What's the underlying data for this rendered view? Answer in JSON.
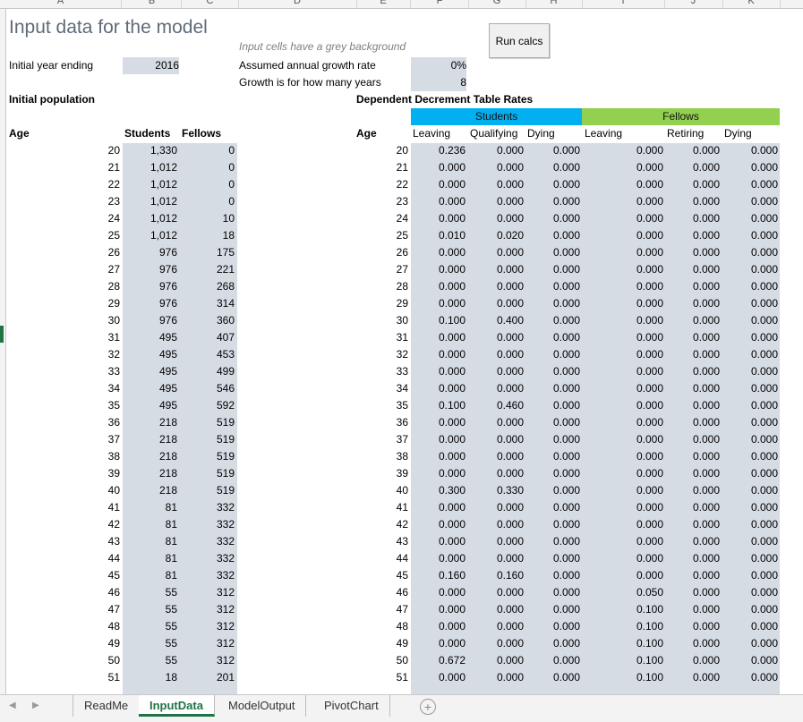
{
  "columns": [
    "A",
    "B",
    "C",
    "D",
    "E",
    "F",
    "G",
    "H",
    "I",
    "J",
    "K"
  ],
  "title": "Input data for the model",
  "note": "Input cells have a grey background",
  "run_button": "Run calcs",
  "initial_year_label": "Initial year ending",
  "initial_year_value": "2016",
  "growth_rate_label": "Assumed annual growth rate",
  "growth_rate_value": "0%",
  "growth_years_label": "Growth is for how many years",
  "growth_years_value": "8",
  "initial_population_label": "Initial population",
  "decrement_title": "Dependent Decrement Table Rates",
  "students_header": "Students",
  "fellows_header": "Fellows",
  "left_headers": {
    "age": "Age",
    "students": "Students",
    "fellows": "Fellows"
  },
  "right_headers": {
    "age": "Age",
    "s_leaving": "Leaving",
    "s_qualifying": "Qualifying",
    "s_dying": "Dying",
    "f_leaving": "Leaving",
    "f_retiring": "Retiring",
    "f_dying": "Dying"
  },
  "rows": [
    [
      "20",
      "1,330",
      "0",
      "20",
      "0.236",
      "0.000",
      "0.000",
      "0.000",
      "0.000",
      "0.000"
    ],
    [
      "21",
      "1,012",
      "0",
      "21",
      "0.000",
      "0.000",
      "0.000",
      "0.000",
      "0.000",
      "0.000"
    ],
    [
      "22",
      "1,012",
      "0",
      "22",
      "0.000",
      "0.000",
      "0.000",
      "0.000",
      "0.000",
      "0.000"
    ],
    [
      "23",
      "1,012",
      "0",
      "23",
      "0.000",
      "0.000",
      "0.000",
      "0.000",
      "0.000",
      "0.000"
    ],
    [
      "24",
      "1,012",
      "10",
      "24",
      "0.000",
      "0.000",
      "0.000",
      "0.000",
      "0.000",
      "0.000"
    ],
    [
      "25",
      "1,012",
      "18",
      "25",
      "0.010",
      "0.020",
      "0.000",
      "0.000",
      "0.000",
      "0.000"
    ],
    [
      "26",
      "976",
      "175",
      "26",
      "0.000",
      "0.000",
      "0.000",
      "0.000",
      "0.000",
      "0.000"
    ],
    [
      "27",
      "976",
      "221",
      "27",
      "0.000",
      "0.000",
      "0.000",
      "0.000",
      "0.000",
      "0.000"
    ],
    [
      "28",
      "976",
      "268",
      "28",
      "0.000",
      "0.000",
      "0.000",
      "0.000",
      "0.000",
      "0.000"
    ],
    [
      "29",
      "976",
      "314",
      "29",
      "0.000",
      "0.000",
      "0.000",
      "0.000",
      "0.000",
      "0.000"
    ],
    [
      "30",
      "976",
      "360",
      "30",
      "0.100",
      "0.400",
      "0.000",
      "0.000",
      "0.000",
      "0.000"
    ],
    [
      "31",
      "495",
      "407",
      "31",
      "0.000",
      "0.000",
      "0.000",
      "0.000",
      "0.000",
      "0.000"
    ],
    [
      "32",
      "495",
      "453",
      "32",
      "0.000",
      "0.000",
      "0.000",
      "0.000",
      "0.000",
      "0.000"
    ],
    [
      "33",
      "495",
      "499",
      "33",
      "0.000",
      "0.000",
      "0.000",
      "0.000",
      "0.000",
      "0.000"
    ],
    [
      "34",
      "495",
      "546",
      "34",
      "0.000",
      "0.000",
      "0.000",
      "0.000",
      "0.000",
      "0.000"
    ],
    [
      "35",
      "495",
      "592",
      "35",
      "0.100",
      "0.460",
      "0.000",
      "0.000",
      "0.000",
      "0.000"
    ],
    [
      "36",
      "218",
      "519",
      "36",
      "0.000",
      "0.000",
      "0.000",
      "0.000",
      "0.000",
      "0.000"
    ],
    [
      "37",
      "218",
      "519",
      "37",
      "0.000",
      "0.000",
      "0.000",
      "0.000",
      "0.000",
      "0.000"
    ],
    [
      "38",
      "218",
      "519",
      "38",
      "0.000",
      "0.000",
      "0.000",
      "0.000",
      "0.000",
      "0.000"
    ],
    [
      "39",
      "218",
      "519",
      "39",
      "0.000",
      "0.000",
      "0.000",
      "0.000",
      "0.000",
      "0.000"
    ],
    [
      "40",
      "218",
      "519",
      "40",
      "0.300",
      "0.330",
      "0.000",
      "0.000",
      "0.000",
      "0.000"
    ],
    [
      "41",
      "81",
      "332",
      "41",
      "0.000",
      "0.000",
      "0.000",
      "0.000",
      "0.000",
      "0.000"
    ],
    [
      "42",
      "81",
      "332",
      "42",
      "0.000",
      "0.000",
      "0.000",
      "0.000",
      "0.000",
      "0.000"
    ],
    [
      "43",
      "81",
      "332",
      "43",
      "0.000",
      "0.000",
      "0.000",
      "0.000",
      "0.000",
      "0.000"
    ],
    [
      "44",
      "81",
      "332",
      "44",
      "0.000",
      "0.000",
      "0.000",
      "0.000",
      "0.000",
      "0.000"
    ],
    [
      "45",
      "81",
      "332",
      "45",
      "0.160",
      "0.160",
      "0.000",
      "0.000",
      "0.000",
      "0.000"
    ],
    [
      "46",
      "55",
      "312",
      "46",
      "0.000",
      "0.000",
      "0.000",
      "0.050",
      "0.000",
      "0.000"
    ],
    [
      "47",
      "55",
      "312",
      "47",
      "0.000",
      "0.000",
      "0.000",
      "0.100",
      "0.000",
      "0.000"
    ],
    [
      "48",
      "55",
      "312",
      "48",
      "0.000",
      "0.000",
      "0.000",
      "0.100",
      "0.000",
      "0.000"
    ],
    [
      "49",
      "55",
      "312",
      "49",
      "0.000",
      "0.000",
      "0.000",
      "0.100",
      "0.000",
      "0.000"
    ],
    [
      "50",
      "55",
      "312",
      "50",
      "0.672",
      "0.000",
      "0.000",
      "0.100",
      "0.000",
      "0.000"
    ],
    [
      "51",
      "18",
      "201",
      "51",
      "0.000",
      "0.000",
      "0.000",
      "0.100",
      "0.000",
      "0.000"
    ]
  ],
  "sheet_tabs": [
    "ReadMe",
    "InputData",
    "ModelOutput",
    "PivotChart"
  ],
  "active_tab": "InputData",
  "colors": {
    "students": "#00b0f0",
    "fellows": "#92d050",
    "input_grey": "#d6dce4",
    "excel_green": "#217346"
  }
}
